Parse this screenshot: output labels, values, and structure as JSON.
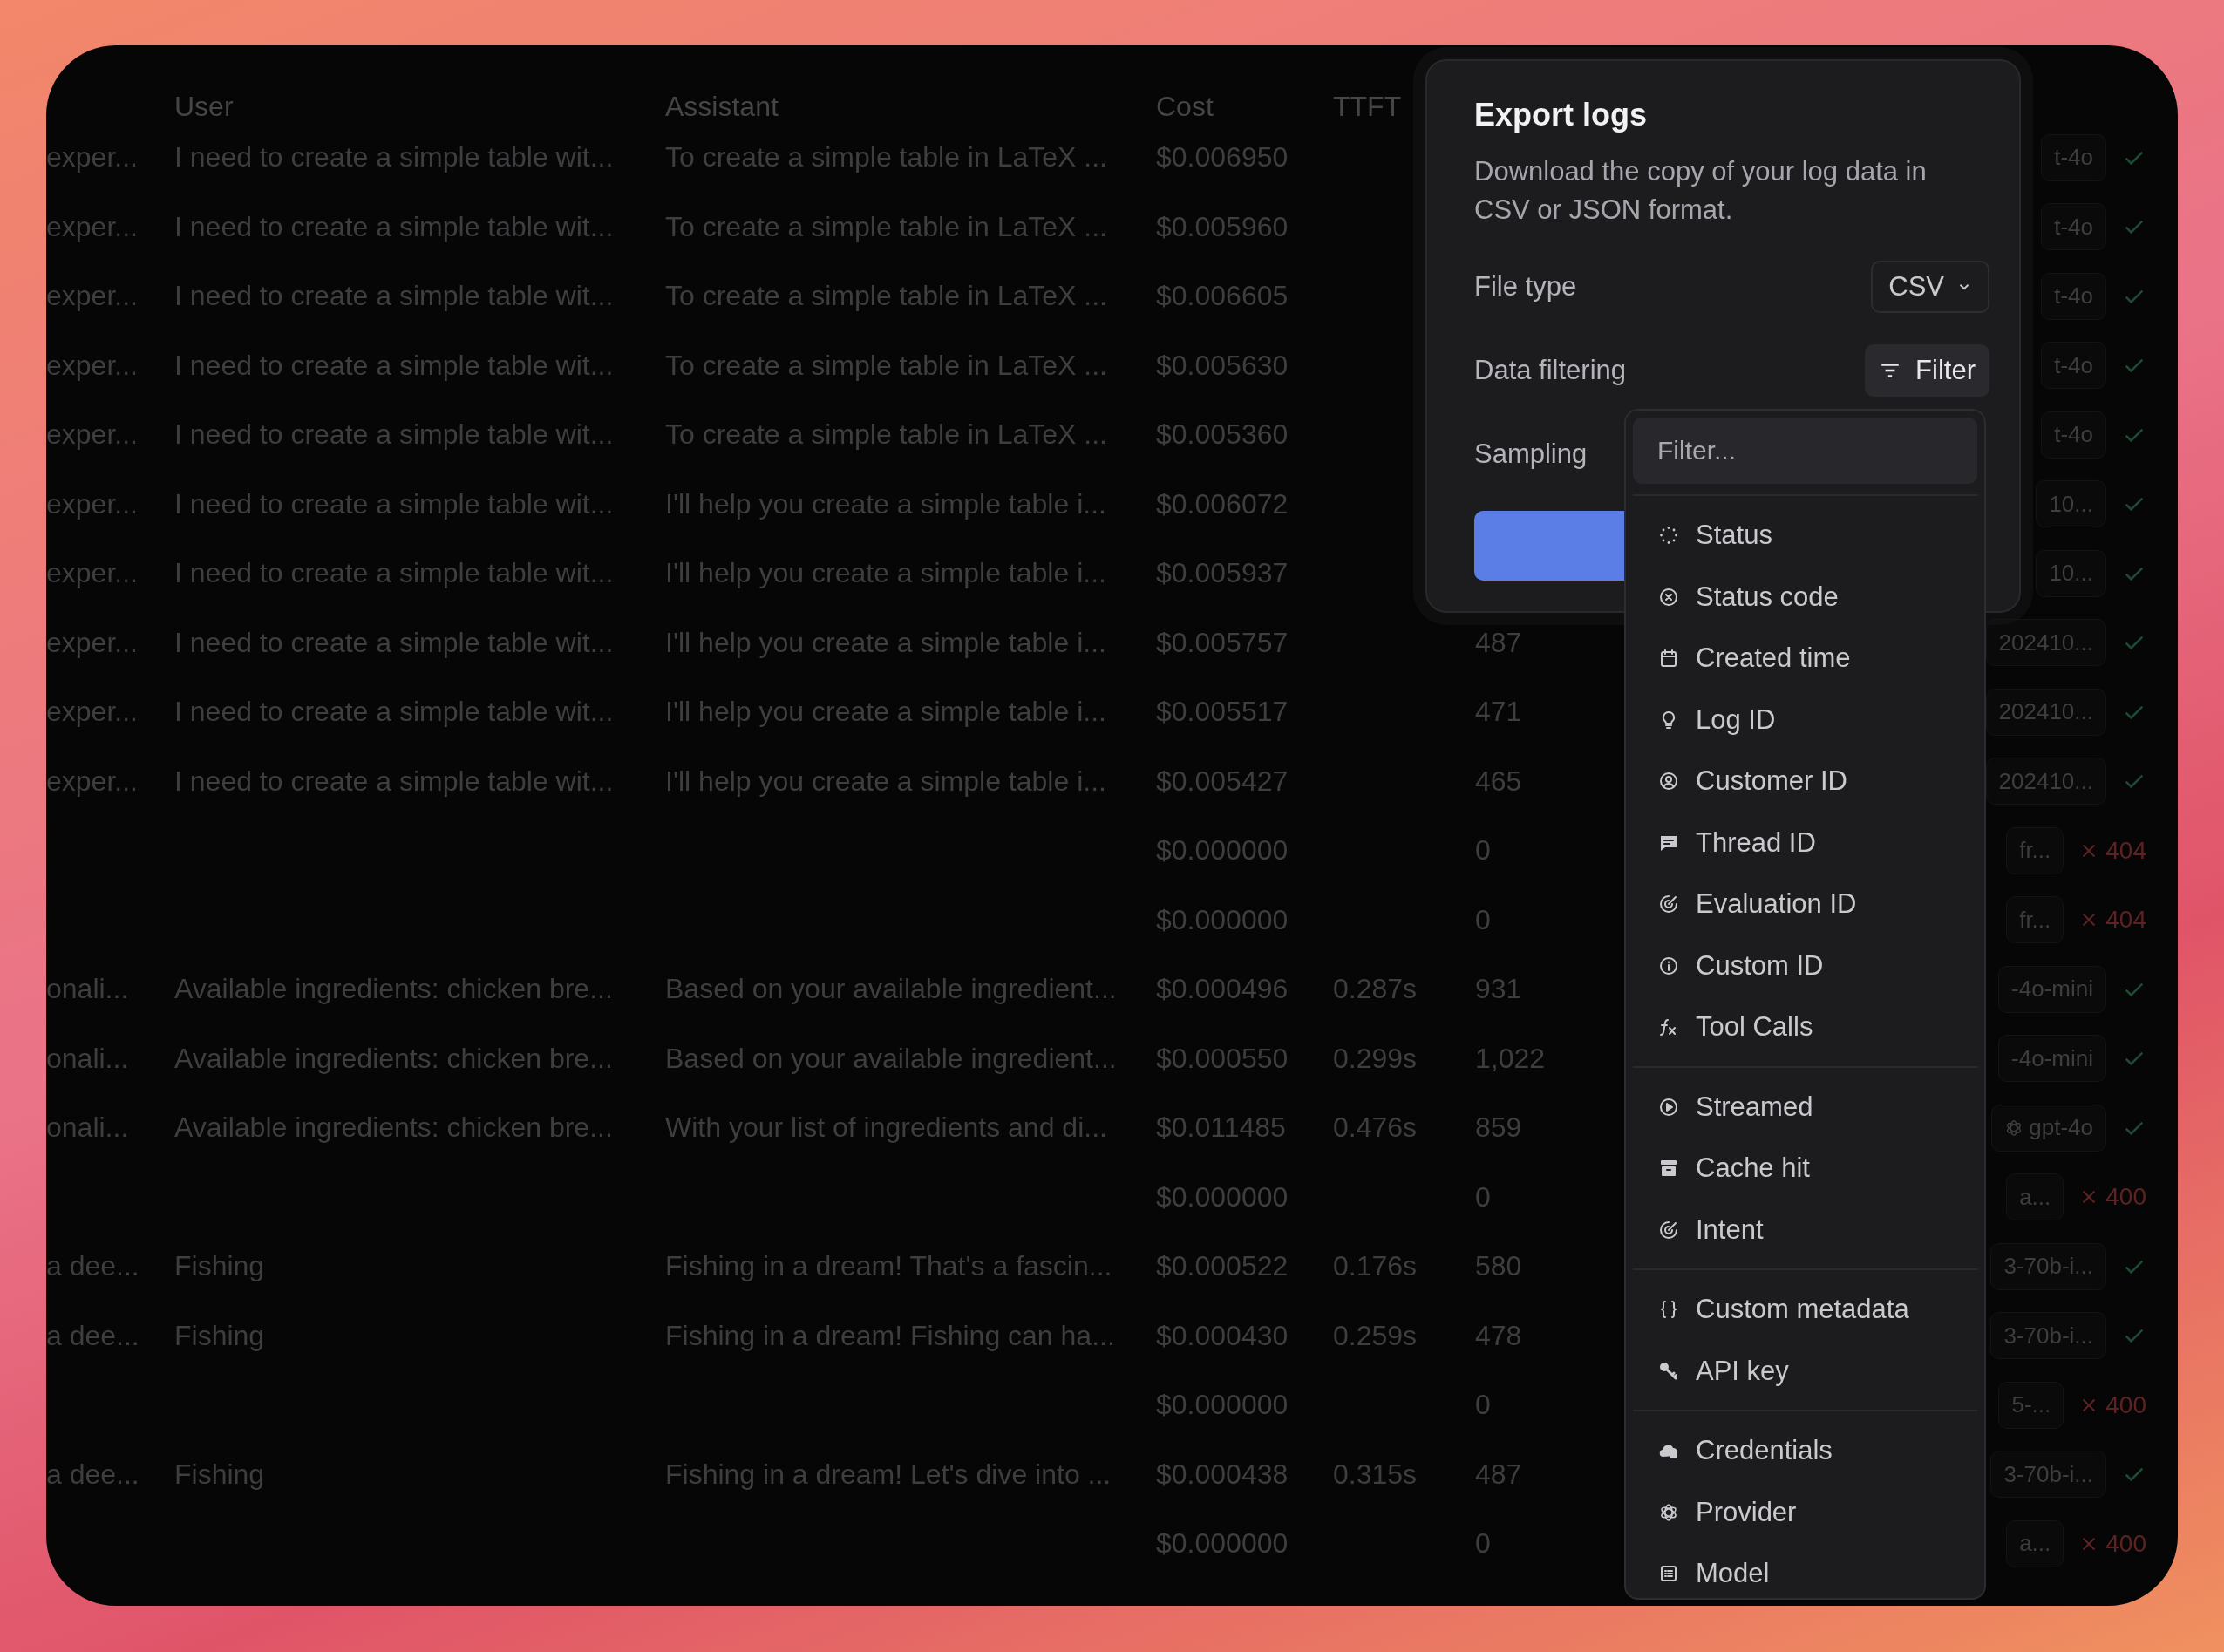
{
  "table": {
    "columns": [
      "User",
      "Assistant",
      "Cost",
      "TTFT"
    ],
    "rows": [
      {
        "column_1": "exper...",
        "user": "I need to create a simple table wit...",
        "assistant": "To create a simple table in LaTeX ...",
        "cost": "$0.006950",
        "model": "t-4o",
        "status": {
          "kind": "success"
        }
      },
      {
        "column_1": "exper...",
        "user": "I need to create a simple table wit...",
        "assistant": "To create a simple table in LaTeX ...",
        "cost": "$0.005960",
        "model": "t-4o",
        "status": {
          "kind": "success"
        }
      },
      {
        "column_1": "exper...",
        "user": "I need to create a simple table wit...",
        "assistant": "To create a simple table in LaTeX ...",
        "cost": "$0.006605",
        "model": "t-4o",
        "status": {
          "kind": "success"
        }
      },
      {
        "column_1": "exper...",
        "user": "I need to create a simple table wit...",
        "assistant": "To create a simple table in LaTeX ...",
        "cost": "$0.005630",
        "model": "t-4o",
        "status": {
          "kind": "success"
        }
      },
      {
        "column_1": "exper...",
        "user": "I need to create a simple table wit...",
        "assistant": "To create a simple table in LaTeX ...",
        "cost": "$0.005360",
        "model": "t-4o",
        "status": {
          "kind": "success"
        }
      },
      {
        "column_1": "exper...",
        "user": "I need to create a simple table wit...",
        "assistant": "I'll help you create a simple table i...",
        "cost": "$0.006072",
        "model": "10...",
        "status": {
          "kind": "success"
        }
      },
      {
        "column_1": "exper...",
        "user": "I need to create a simple table wit...",
        "assistant": "I'll help you create a simple table i...",
        "cost": "$0.005937",
        "model": "10...",
        "status": {
          "kind": "success"
        }
      },
      {
        "column_1": "exper...",
        "user": "I need to create a simple table wit...",
        "assistant": "I'll help you create a simple table i...",
        "cost": "$0.005757",
        "tokens": "487",
        "model": "202410...",
        "status": {
          "kind": "success"
        }
      },
      {
        "column_1": "exper...",
        "user": "I need to create a simple table wit...",
        "assistant": "I'll help you create a simple table i...",
        "cost": "$0.005517",
        "tokens": "471",
        "model": "202410...",
        "status": {
          "kind": "success"
        }
      },
      {
        "column_1": "exper...",
        "user": "I need to create a simple table wit...",
        "assistant": "I'll help you create a simple table i...",
        "cost": "$0.005427",
        "tokens": "465",
        "model": "202410...",
        "status": {
          "kind": "success"
        }
      },
      {
        "cost": "$0.000000",
        "tokens": "0",
        "model": "fr...",
        "status": {
          "kind": "error",
          "code": "404"
        }
      },
      {
        "cost": "$0.000000",
        "tokens": "0",
        "model": "fr...",
        "status": {
          "kind": "error",
          "code": "404"
        }
      },
      {
        "column_1": "onali...",
        "user": "Available ingredients: chicken bre...",
        "assistant": "Based on your available ingredient...",
        "cost": "$0.000496",
        "ttft": "0.287s",
        "tokens": "931",
        "model": "-4o-mini",
        "status": {
          "kind": "success"
        }
      },
      {
        "column_1": "onali...",
        "user": "Available ingredients: chicken bre...",
        "assistant": "Based on your available ingredient...",
        "cost": "$0.000550",
        "ttft": "0.299s",
        "tokens": "1,022",
        "model": "-4o-mini",
        "status": {
          "kind": "success"
        }
      },
      {
        "column_1": "onali...",
        "user": "Available ingredients: chicken bre...",
        "assistant": "With your list of ingredients and di...",
        "cost": "$0.011485",
        "ttft": "0.476s",
        "tokens": "859",
        "model": "gpt-4o",
        "model_icon": true,
        "status": {
          "kind": "success"
        }
      },
      {
        "cost": "$0.000000",
        "tokens": "0",
        "model": "a...",
        "status": {
          "kind": "error",
          "code": "400"
        }
      },
      {
        "column_1": "a dee...",
        "user": "Fishing",
        "assistant": "Fishing in a dream! That's a fascin...",
        "cost": "$0.000522",
        "ttft": "0.176s",
        "tokens": "580",
        "model": "3-70b-i...",
        "status": {
          "kind": "success"
        }
      },
      {
        "column_1": "a dee...",
        "user": "Fishing",
        "assistant": "Fishing in a dream! Fishing can ha...",
        "cost": "$0.000430",
        "ttft": "0.259s",
        "tokens": "478",
        "model": "3-70b-i...",
        "status": {
          "kind": "success"
        }
      },
      {
        "cost": "$0.000000",
        "tokens": "0",
        "model": "5-...",
        "status": {
          "kind": "error",
          "code": "400"
        }
      },
      {
        "column_1": "a dee...",
        "user": "Fishing",
        "assistant": "Fishing in a dream! Let's dive into ...",
        "cost": "$0.000438",
        "ttft": "0.315s",
        "tokens": "487",
        "model": "3-70b-i...",
        "status": {
          "kind": "success"
        }
      },
      {
        "cost": "$0.000000",
        "tokens": "0",
        "model": "a...",
        "status": {
          "kind": "error",
          "code": "400"
        }
      }
    ]
  },
  "export_dialog": {
    "title": "Export logs",
    "description": "Download the copy of your log data in CSV or JSON format.",
    "fields": [
      {
        "label": "File type",
        "kind": "select",
        "value": "CSV"
      },
      {
        "label": "Data filtering",
        "kind": "filter",
        "value": "Filter"
      },
      {
        "label": "Sampling",
        "kind": "blank"
      }
    ]
  },
  "filter_menu": {
    "placeholder": "Filter...",
    "groups": [
      {
        "items": [
          {
            "label": "Status"
          },
          {
            "label": "Status code"
          },
          {
            "label": "Created time"
          },
          {
            "label": "Log ID"
          },
          {
            "label": "Customer ID"
          },
          {
            "label": "Thread ID"
          },
          {
            "label": "Evaluation ID"
          },
          {
            "label": "Custom ID"
          },
          {
            "label": "Tool Calls"
          }
        ]
      },
      {
        "items": [
          {
            "label": "Streamed"
          },
          {
            "label": "Cache hit"
          },
          {
            "label": "Intent"
          }
        ]
      },
      {
        "items": [
          {
            "label": "Custom metadata"
          },
          {
            "label": "API key"
          }
        ]
      },
      {
        "items": [
          {
            "label": "Credentials"
          },
          {
            "label": "Provider"
          },
          {
            "label": "Model"
          }
        ]
      }
    ]
  }
}
